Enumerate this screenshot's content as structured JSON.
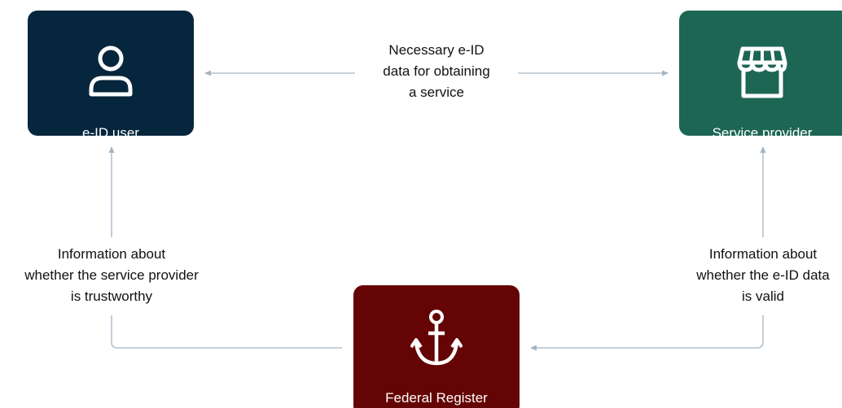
{
  "nodes": {
    "user": {
      "label": "e-ID user",
      "icon": "person-icon",
      "color": "#06263d"
    },
    "provider": {
      "label": "Service provider",
      "icon": "storefront-icon",
      "color": "#1d6654"
    },
    "register": {
      "label": "Federal Register",
      "icon": "anchor-icon",
      "color": "#650404"
    }
  },
  "edges": {
    "top": {
      "lines": [
        "Necessary e-ID",
        "data for obtaining",
        "a service"
      ],
      "direction": "bidirectional"
    },
    "left": {
      "lines": [
        "Information about",
        "whether the service provider",
        "is trustworthy"
      ],
      "direction": "register-to-user"
    },
    "right": {
      "lines": [
        "Information about",
        "whether the e-ID data",
        "is valid"
      ],
      "direction": "provider-to-register"
    }
  },
  "colors": {
    "connector": "#a3b5c3",
    "text": "#111111"
  }
}
